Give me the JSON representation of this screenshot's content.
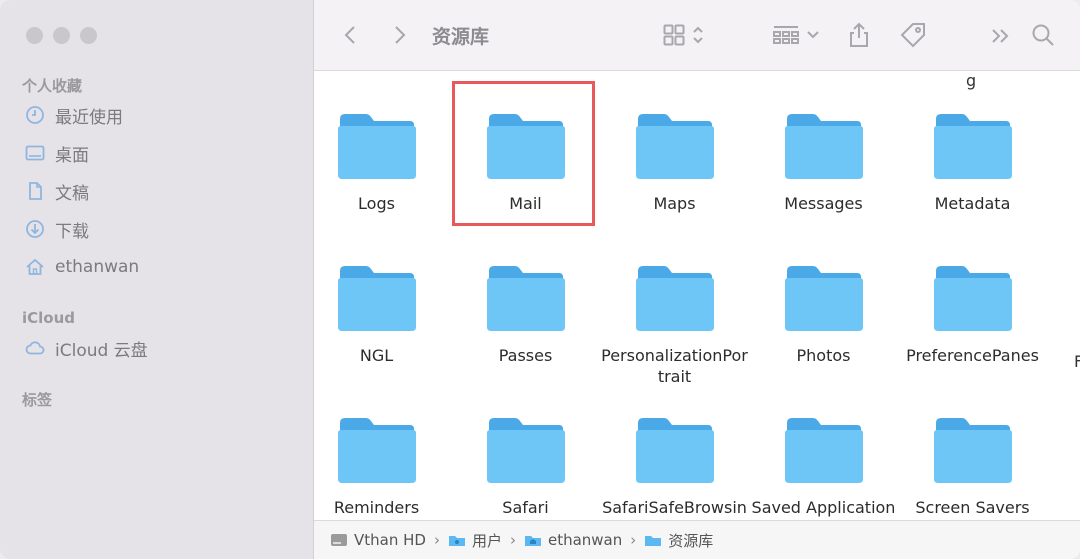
{
  "window": {
    "title": "资源库"
  },
  "sidebar": {
    "favorites_header": "个人收藏",
    "favorites": [
      {
        "label": "最近使用",
        "icon": "clock-icon"
      },
      {
        "label": "桌面",
        "icon": "desktop-icon"
      },
      {
        "label": "文稿",
        "icon": "document-icon"
      },
      {
        "label": "下载",
        "icon": "download-icon"
      },
      {
        "label": "ethanwan",
        "icon": "home-icon"
      }
    ],
    "icloud_header": "iCloud",
    "icloud": [
      {
        "label": "iCloud 云盘",
        "icon": "cloud-icon"
      }
    ],
    "tags_header": "标签"
  },
  "content": {
    "top_partial": "g",
    "edge_partial": "F",
    "items": [
      {
        "label": "Logs"
      },
      {
        "label": "Mail",
        "selected": true
      },
      {
        "label": "Maps"
      },
      {
        "label": "Messages"
      },
      {
        "label": "Metadata"
      },
      {
        "label": "NGL"
      },
      {
        "label": "Passes"
      },
      {
        "label": "PersonalizationPortrait"
      },
      {
        "label": "Photos"
      },
      {
        "label": "PreferencePanes"
      },
      {
        "label": "Reminders"
      },
      {
        "label": "Safari"
      },
      {
        "label": "SafariSafeBrowsin"
      },
      {
        "label": "Saved Application"
      },
      {
        "label": "Screen Savers"
      }
    ]
  },
  "pathbar": {
    "crumbs": [
      "Vthan HD",
      "用户",
      "ethanwan",
      "资源库"
    ],
    "separator": "›"
  },
  "colors": {
    "folder": "#6ec6f7",
    "folder_tab": "#4aa9e6",
    "selection": "#e85a5a"
  }
}
